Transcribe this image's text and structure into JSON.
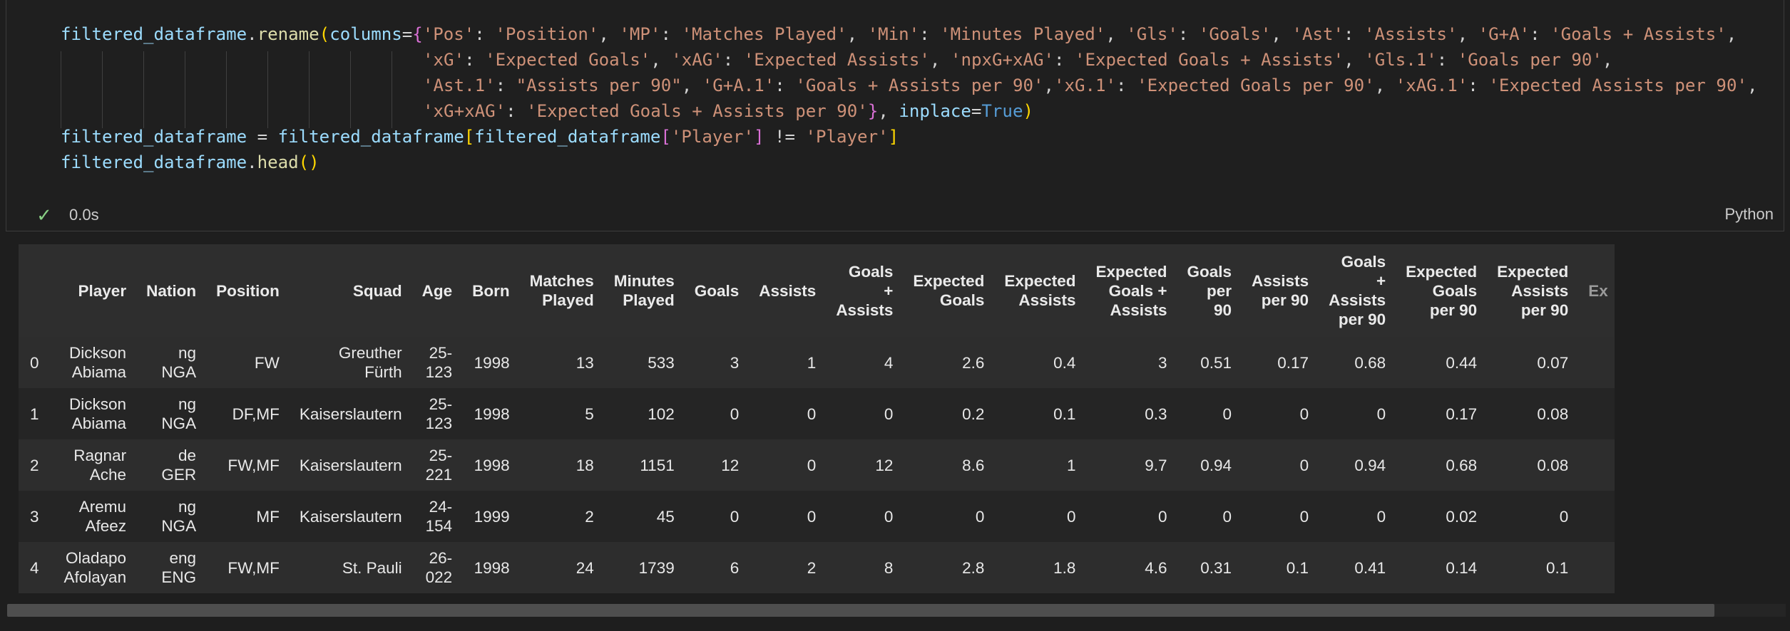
{
  "code": {
    "lines": [
      "filtered_dataframe.rename(columns={'Pos': 'Position', 'MP': 'Matches Played', 'Min': 'Minutes Played', 'Gls': 'Goals', 'Ast': 'Assists', 'G+A': 'Goals + Assists',",
      "                                   'xG': 'Expected Goals', 'xAG': 'Expected Assists', 'npxG+xAG': 'Expected Goals + Assists', 'Gls.1': 'Goals per 90',",
      "                                   'Ast.1': \"Assists per 90\", 'G+A.1': 'Goals + Assists per 90','xG.1': 'Expected Goals per 90', 'xAG.1': 'Expected Assists per 90',",
      "                                   'xG+xAG': 'Expected Goals + Assists per 90'}, inplace=True)",
      "filtered_dataframe = filtered_dataframe[filtered_dataframe['Player'] != 'Player']",
      "filtered_dataframe.head()"
    ]
  },
  "status": {
    "check_icon": "check-icon",
    "time": "0.0s",
    "language": "Python"
  },
  "table": {
    "headers": [
      [
        "Player"
      ],
      [
        "Nation"
      ],
      [
        "Position"
      ],
      [
        "Squad"
      ],
      [
        "Age"
      ],
      [
        "Born"
      ],
      [
        "Matches",
        "Played"
      ],
      [
        "Minutes",
        "Played"
      ],
      [
        "Goals"
      ],
      [
        "Assists"
      ],
      [
        "Goals",
        "+",
        "Assists"
      ],
      [
        "Expected",
        "Goals"
      ],
      [
        "Expected",
        "Assists"
      ],
      [
        "Expected",
        "Goals +",
        "Assists"
      ],
      [
        "Goals",
        "per",
        "90"
      ],
      [
        "Assists",
        "per 90"
      ],
      [
        "Goals",
        "+",
        "Assists",
        "per 90"
      ],
      [
        "Expected",
        "Goals",
        "per 90"
      ],
      [
        "Expected",
        "Assists",
        "per 90"
      ],
      [
        "Ex"
      ]
    ],
    "rows": [
      {
        "index": "0",
        "cells": [
          [
            "Dickson",
            "Abiama"
          ],
          [
            "ng",
            "NGA"
          ],
          [
            "FW"
          ],
          [
            "Greuther",
            "Fürth"
          ],
          [
            "25-",
            "123"
          ],
          [
            "1998"
          ],
          [
            "13"
          ],
          [
            "533"
          ],
          [
            "3"
          ],
          [
            "1"
          ],
          [
            "4"
          ],
          [
            "2.6"
          ],
          [
            "0.4"
          ],
          [
            "3"
          ],
          [
            "0.51"
          ],
          [
            "0.17"
          ],
          [
            "0.68"
          ],
          [
            "0.44"
          ],
          [
            "0.07"
          ],
          [
            ""
          ]
        ]
      },
      {
        "index": "1",
        "cells": [
          [
            "Dickson",
            "Abiama"
          ],
          [
            "ng",
            "NGA"
          ],
          [
            "DF,MF"
          ],
          [
            "Kaiserslautern"
          ],
          [
            "25-",
            "123"
          ],
          [
            "1998"
          ],
          [
            "5"
          ],
          [
            "102"
          ],
          [
            "0"
          ],
          [
            "0"
          ],
          [
            "0"
          ],
          [
            "0.2"
          ],
          [
            "0.1"
          ],
          [
            "0.3"
          ],
          [
            "0"
          ],
          [
            "0"
          ],
          [
            "0"
          ],
          [
            "0.17"
          ],
          [
            "0.08"
          ],
          [
            ""
          ]
        ]
      },
      {
        "index": "2",
        "cells": [
          [
            "Ragnar",
            "Ache"
          ],
          [
            "de",
            "GER"
          ],
          [
            "FW,MF"
          ],
          [
            "Kaiserslautern"
          ],
          [
            "25-",
            "221"
          ],
          [
            "1998"
          ],
          [
            "18"
          ],
          [
            "1151"
          ],
          [
            "12"
          ],
          [
            "0"
          ],
          [
            "12"
          ],
          [
            "8.6"
          ],
          [
            "1"
          ],
          [
            "9.7"
          ],
          [
            "0.94"
          ],
          [
            "0"
          ],
          [
            "0.94"
          ],
          [
            "0.68"
          ],
          [
            "0.08"
          ],
          [
            ""
          ]
        ]
      },
      {
        "index": "3",
        "cells": [
          [
            "Aremu",
            "Afeez"
          ],
          [
            "ng",
            "NGA"
          ],
          [
            "MF"
          ],
          [
            "Kaiserslautern"
          ],
          [
            "24-",
            "154"
          ],
          [
            "1999"
          ],
          [
            "2"
          ],
          [
            "45"
          ],
          [
            "0"
          ],
          [
            "0"
          ],
          [
            "0"
          ],
          [
            "0"
          ],
          [
            "0"
          ],
          [
            "0"
          ],
          [
            "0"
          ],
          [
            "0"
          ],
          [
            "0"
          ],
          [
            "0.02"
          ],
          [
            "0"
          ],
          [
            ""
          ]
        ]
      },
      {
        "index": "4",
        "cells": [
          [
            "Oladapo",
            "Afolayan"
          ],
          [
            "eng",
            "ENG"
          ],
          [
            "FW,MF"
          ],
          [
            "St. Pauli"
          ],
          [
            "26-",
            "022"
          ],
          [
            "1998"
          ],
          [
            "24"
          ],
          [
            "1739"
          ],
          [
            "6"
          ],
          [
            "2"
          ],
          [
            "8"
          ],
          [
            "2.8"
          ],
          [
            "1.8"
          ],
          [
            "4.6"
          ],
          [
            "0.31"
          ],
          [
            "0.1"
          ],
          [
            "0.41"
          ],
          [
            "0.14"
          ],
          [
            "0.1"
          ],
          [
            ""
          ]
        ]
      }
    ]
  }
}
